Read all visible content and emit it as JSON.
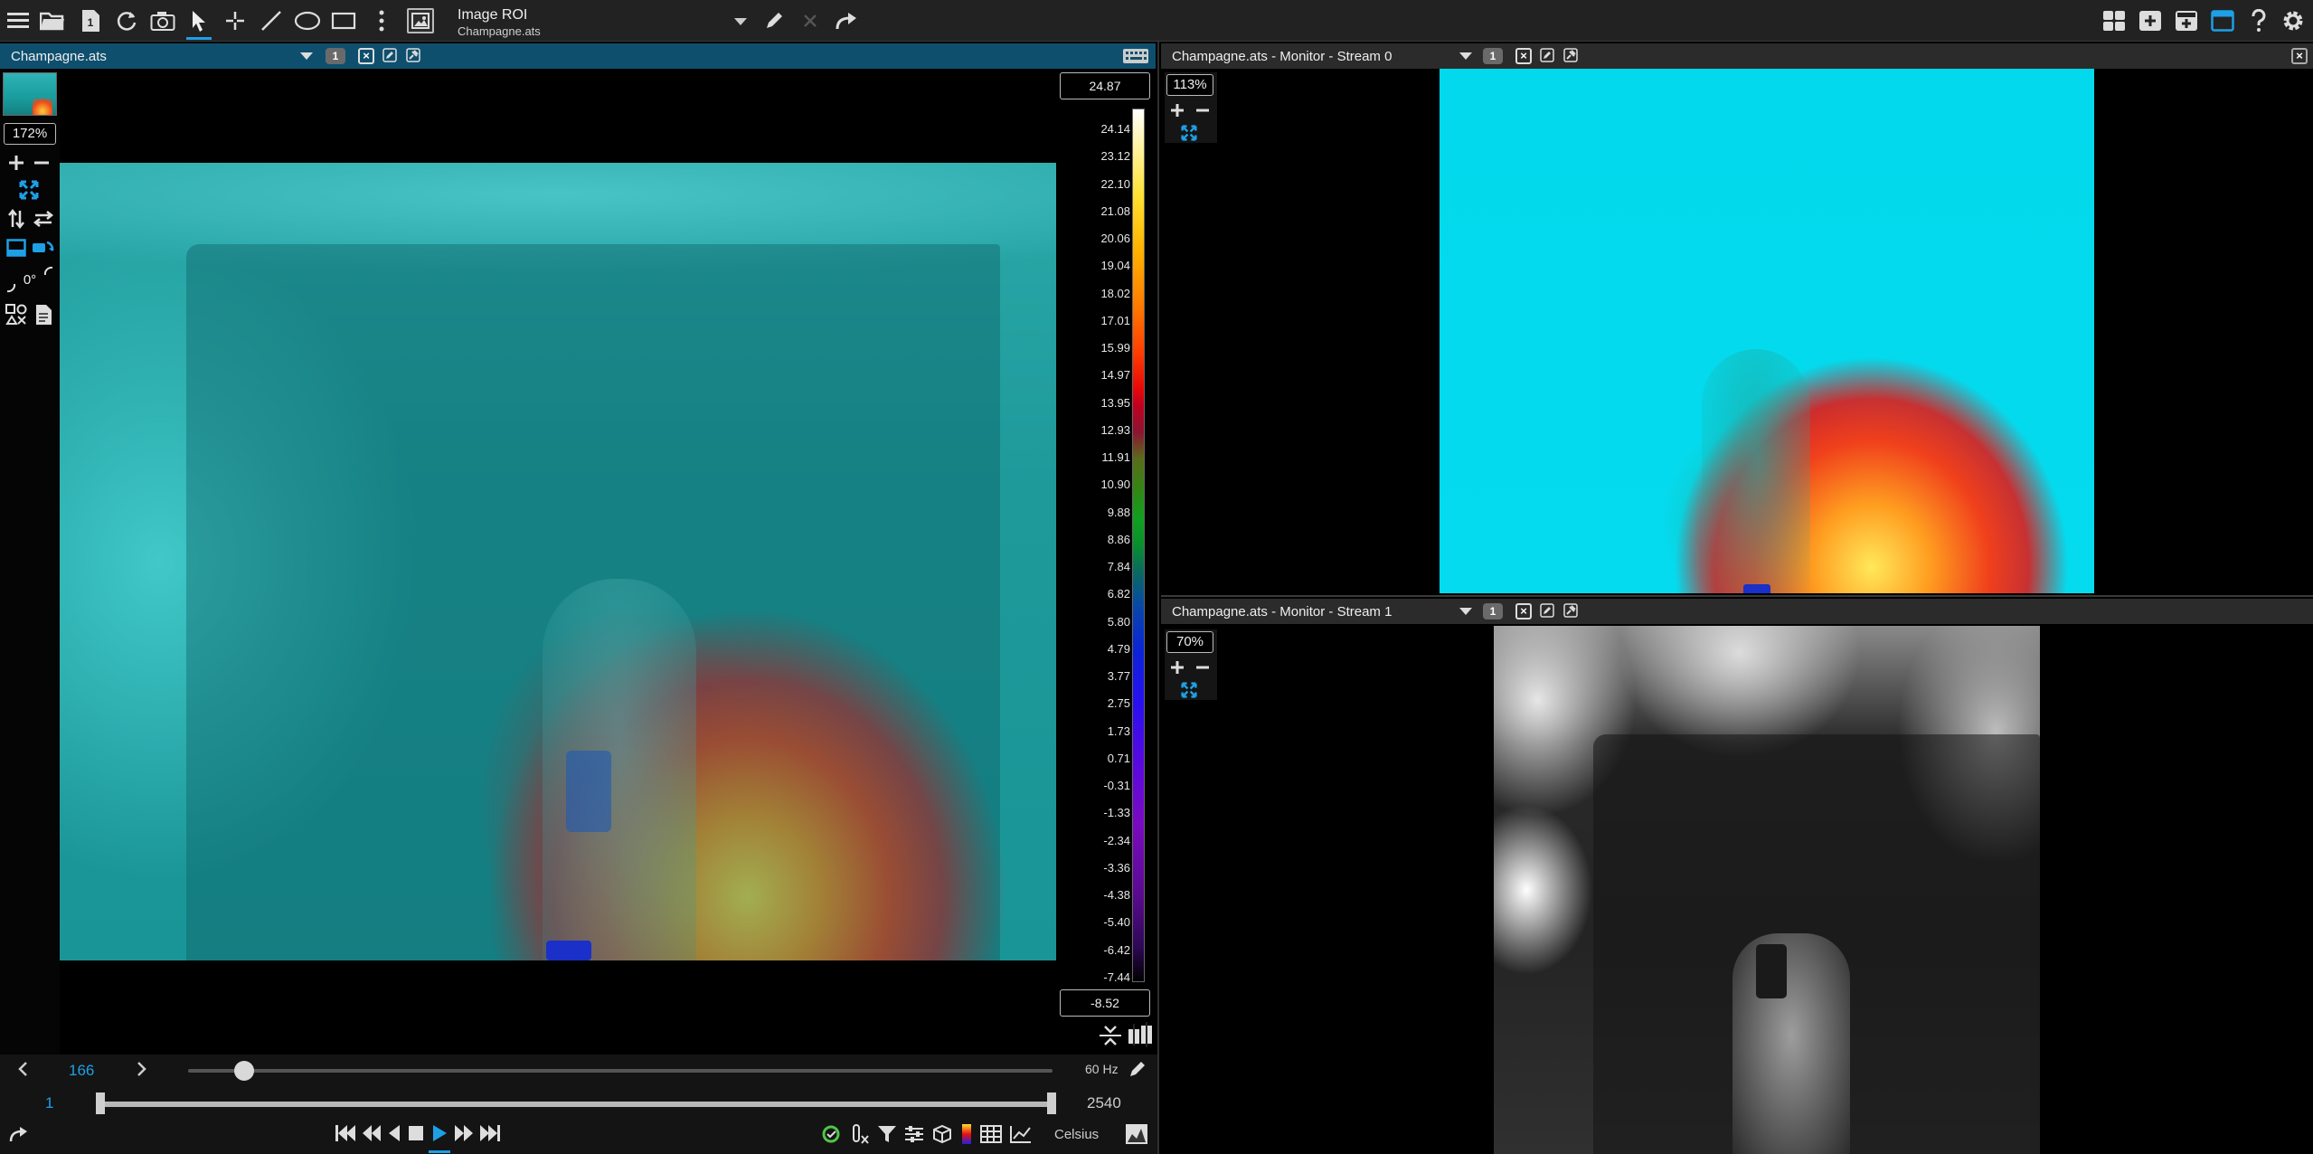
{
  "toolbar": {
    "roi_title": "Image ROI",
    "roi_subtitle": "Champagne.ats"
  },
  "main_panel": {
    "title": "Champagne.ats",
    "badge": "1",
    "zoom": "172%",
    "rotation": "0°"
  },
  "colorbar": {
    "max": "24.87",
    "min": "-8.52",
    "ticks": [
      "24.14",
      "23.12",
      "22.10",
      "21.08",
      "20.06",
      "19.04",
      "18.02",
      "17.01",
      "15.99",
      "14.97",
      "13.95",
      "12.93",
      "11.91",
      "10.90",
      "9.88",
      "8.86",
      "7.84",
      "6.82",
      "5.80",
      "4.79",
      "3.77",
      "2.75",
      "1.73",
      "0.71",
      "-0.31",
      "-1.33",
      "-2.34",
      "-3.36",
      "-4.38",
      "-5.40",
      "-6.42",
      "-7.44"
    ]
  },
  "playback": {
    "current_frame": "166",
    "frame_rate": "60 Hz",
    "range_start": "1",
    "range_end": "2540",
    "current_fraction": 0.065,
    "units": "Celsius"
  },
  "monitor0": {
    "title": "Champagne.ats - Monitor - Stream 0",
    "badge": "1",
    "zoom": "113%"
  },
  "monitor1": {
    "title": "Champagne.ats - Monitor - Stream 1",
    "badge": "1",
    "zoom": "70%"
  },
  "colors": {
    "accent": "#1ea0e6",
    "header_active": "#0f4f6e"
  }
}
